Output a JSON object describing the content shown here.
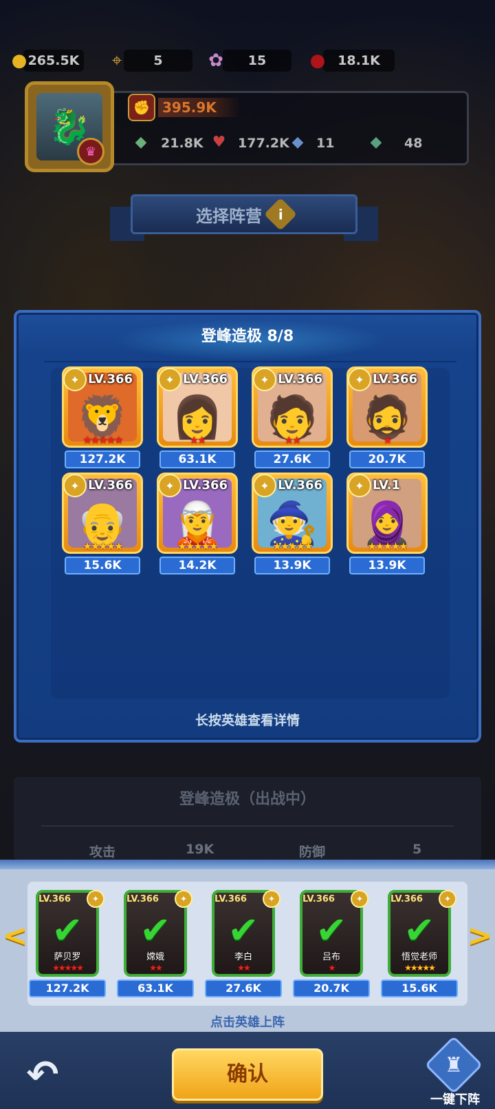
{
  "resources": [
    {
      "name": "gold",
      "icon": "gold-coin-icon",
      "value": "265.5K"
    },
    {
      "name": "scroll",
      "icon": "scroll-icon",
      "value": "5"
    },
    {
      "name": "crystal",
      "icon": "crystal-icon",
      "value": "15"
    },
    {
      "name": "blood",
      "icon": "blood-drop-icon",
      "value": "18.1K"
    }
  ],
  "profile": {
    "power": "395.9K",
    "stats": [
      {
        "icon": "attack-icon",
        "value": "21.8K"
      },
      {
        "icon": "health-icon",
        "value": "177.2K"
      },
      {
        "icon": "defense-icon",
        "value": "11"
      },
      {
        "icon": "speed-icon",
        "value": "48"
      }
    ]
  },
  "faction": {
    "label": "选择阵营"
  },
  "panel": {
    "title": "登峰造极 8/8",
    "hint": "长按英雄查看详情",
    "heroes": [
      {
        "level": "LV.366",
        "stars": "red5",
        "power": "127.2K",
        "portrait": "🦁"
      },
      {
        "level": "LV.366",
        "stars": "red2",
        "power": "63.1K",
        "portrait": "👩"
      },
      {
        "level": "LV.366",
        "stars": "red2",
        "power": "27.6K",
        "portrait": "🧑"
      },
      {
        "level": "LV.366",
        "stars": "red1",
        "power": "20.7K",
        "portrait": "🧔"
      },
      {
        "level": "LV.366",
        "stars": "gold5",
        "power": "15.6K",
        "portrait": "👴"
      },
      {
        "level": "LV.366",
        "stars": "gold5",
        "power": "14.2K",
        "portrait": "🧝"
      },
      {
        "level": "LV.366",
        "stars": "gold5",
        "power": "13.9K",
        "portrait": "🧙"
      },
      {
        "level": "LV.1",
        "stars": "gold5",
        "power": "13.9K",
        "portrait": "🧕"
      }
    ]
  },
  "behind": {
    "title": "登峰造极（出战中）",
    "attack_label": "攻击",
    "attack_value": "19K",
    "defense_label": "防御",
    "defense_value": "5"
  },
  "deployed": {
    "hint": "点击英雄上阵",
    "slots": [
      {
        "level": "LV.366",
        "name": "萨贝罗",
        "stars": "red5",
        "power": "127.2K"
      },
      {
        "level": "LV.366",
        "name": "嫦娥",
        "stars": "red2",
        "power": "63.1K"
      },
      {
        "level": "LV.366",
        "name": "李白",
        "stars": "red2",
        "power": "27.6K"
      },
      {
        "level": "LV.366",
        "name": "吕布",
        "stars": "red1",
        "power": "20.7K"
      },
      {
        "level": "LV.366",
        "name": "悟觉老师",
        "stars": "gold5",
        "power": "15.6K"
      }
    ]
  },
  "buttons": {
    "confirm": "确认",
    "undeploy": "一键下阵"
  },
  "colors": {
    "panel_blue": "#15428a",
    "power_blue": "#2a6cd4",
    "confirm_gold": "#f0a418",
    "check_green": "#36d435"
  }
}
